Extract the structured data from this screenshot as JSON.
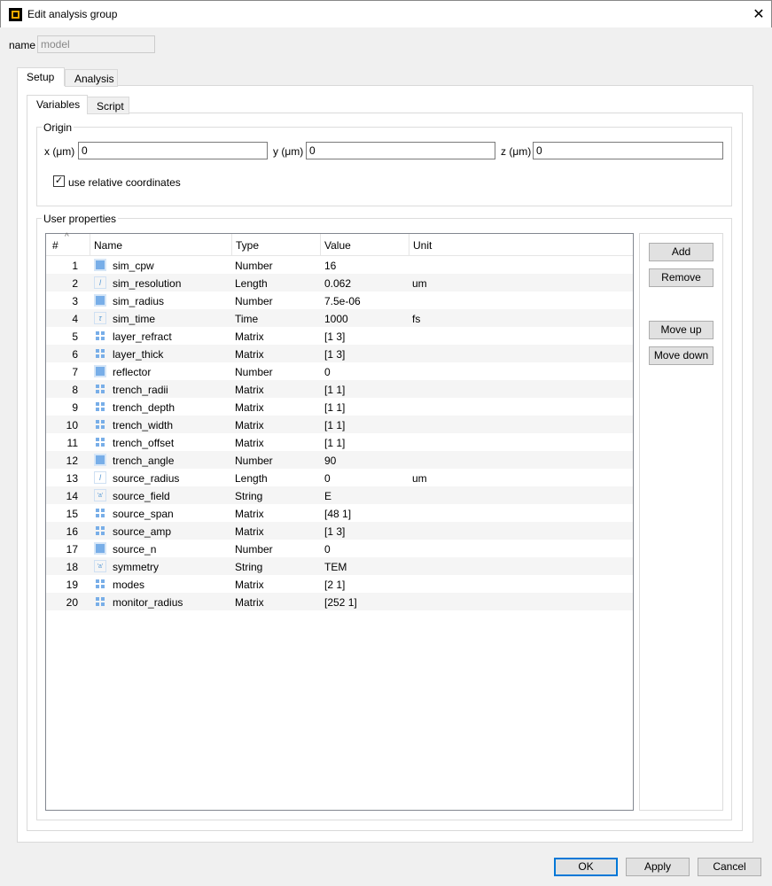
{
  "window": {
    "title": "Edit analysis group",
    "close": "✕"
  },
  "name": {
    "label": "name",
    "value": "model"
  },
  "tabs": [
    {
      "label": "Setup"
    },
    {
      "label": "Analysis"
    }
  ],
  "subtabs": [
    {
      "label": "Variables"
    },
    {
      "label": "Script"
    }
  ],
  "origin": {
    "title": "Origin",
    "x_label": "x (μm)",
    "x": "0",
    "y_label": "y (μm)",
    "y": "0",
    "z_label": "z (μm)",
    "z": "0",
    "relative_label": "use relative coordinates",
    "relative_checked": true
  },
  "user_properties": {
    "title": "User properties",
    "columns": [
      "#",
      "Name",
      "Type",
      "Value",
      "Unit"
    ],
    "rows": [
      {
        "n": "1",
        "name": "sim_cpw",
        "type": "Number",
        "value": "16",
        "unit": "",
        "icon": "number"
      },
      {
        "n": "2",
        "name": "sim_resolution",
        "type": "Length",
        "value": "0.062",
        "unit": "um",
        "icon": "length"
      },
      {
        "n": "3",
        "name": "sim_radius",
        "type": "Number",
        "value": "7.5e-06",
        "unit": "",
        "icon": "number"
      },
      {
        "n": "4",
        "name": "sim_time",
        "type": "Time",
        "value": "1000",
        "unit": "fs",
        "icon": "time"
      },
      {
        "n": "5",
        "name": "layer_refract",
        "type": "Matrix",
        "value": "[1 3]",
        "unit": "",
        "icon": "matrix"
      },
      {
        "n": "6",
        "name": "layer_thick",
        "type": "Matrix",
        "value": "[1 3]",
        "unit": "",
        "icon": "matrix"
      },
      {
        "n": "7",
        "name": "reflector",
        "type": "Number",
        "value": "0",
        "unit": "",
        "icon": "number"
      },
      {
        "n": "8",
        "name": "trench_radii",
        "type": "Matrix",
        "value": "[1 1]",
        "unit": "",
        "icon": "matrix"
      },
      {
        "n": "9",
        "name": "trench_depth",
        "type": "Matrix",
        "value": "[1 1]",
        "unit": "",
        "icon": "matrix"
      },
      {
        "n": "10",
        "name": "trench_width",
        "type": "Matrix",
        "value": "[1 1]",
        "unit": "",
        "icon": "matrix"
      },
      {
        "n": "11",
        "name": "trench_offset",
        "type": "Matrix",
        "value": "[1 1]",
        "unit": "",
        "icon": "matrix"
      },
      {
        "n": "12",
        "name": "trench_angle",
        "type": "Number",
        "value": "90",
        "unit": "",
        "icon": "number"
      },
      {
        "n": "13",
        "name": "source_radius",
        "type": "Length",
        "value": "0",
        "unit": "um",
        "icon": "length"
      },
      {
        "n": "14",
        "name": "source_field",
        "type": "String",
        "value": "E",
        "unit": "",
        "icon": "string"
      },
      {
        "n": "15",
        "name": "source_span",
        "type": "Matrix",
        "value": "[48 1]",
        "unit": "",
        "icon": "matrix"
      },
      {
        "n": "16",
        "name": "source_amp",
        "type": "Matrix",
        "value": "[1 3]",
        "unit": "",
        "icon": "matrix"
      },
      {
        "n": "17",
        "name": "source_n",
        "type": "Number",
        "value": "0",
        "unit": "",
        "icon": "number"
      },
      {
        "n": "18",
        "name": "symmetry",
        "type": "String",
        "value": "TEM",
        "unit": "",
        "icon": "string"
      },
      {
        "n": "19",
        "name": "modes",
        "type": "Matrix",
        "value": "[2 1]",
        "unit": "",
        "icon": "matrix"
      },
      {
        "n": "20",
        "name": "monitor_radius",
        "type": "Matrix",
        "value": "[252 1]",
        "unit": "",
        "icon": "matrix"
      }
    ],
    "buttons": {
      "add": "Add",
      "remove": "Remove",
      "move_up": "Move up",
      "move_down": "Move down"
    }
  },
  "footer": {
    "ok": "OK",
    "apply": "Apply",
    "cancel": "Cancel"
  }
}
